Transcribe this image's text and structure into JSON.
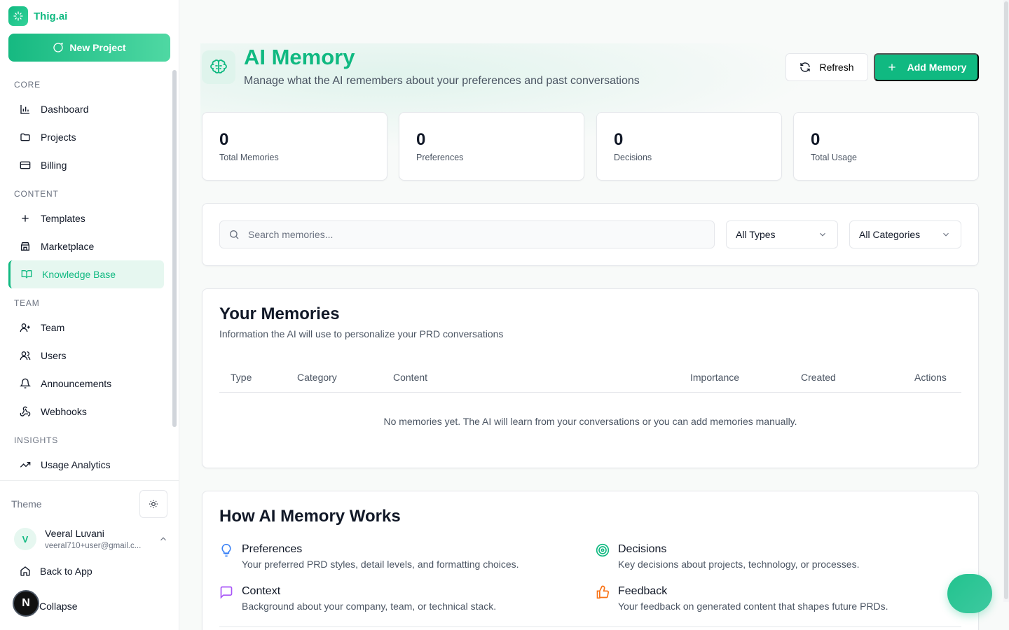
{
  "brand": {
    "name": "Thig.ai"
  },
  "sidebar": {
    "new_project": "New Project",
    "sections": [
      {
        "label": "CORE",
        "items": [
          {
            "label": "Dashboard",
            "icon": "bar-chart-icon"
          },
          {
            "label": "Projects",
            "icon": "folder-icon"
          },
          {
            "label": "Billing",
            "icon": "credit-card-icon"
          }
        ]
      },
      {
        "label": "CONTENT",
        "items": [
          {
            "label": "Templates",
            "icon": "plus-icon"
          },
          {
            "label": "Marketplace",
            "icon": "store-icon"
          },
          {
            "label": "Knowledge Base",
            "icon": "book-open-icon",
            "active": true
          }
        ]
      },
      {
        "label": "TEAM",
        "items": [
          {
            "label": "Team",
            "icon": "user-plus-icon"
          },
          {
            "label": "Users",
            "icon": "users-icon"
          },
          {
            "label": "Announcements",
            "icon": "bell-icon"
          },
          {
            "label": "Webhooks",
            "icon": "webhook-icon"
          }
        ]
      },
      {
        "label": "INSIGHTS",
        "items": [
          {
            "label": "Usage Analytics",
            "icon": "trending-up-icon"
          }
        ]
      }
    ],
    "theme_label": "Theme",
    "user": {
      "initial": "V",
      "name": "Veeral Luvani",
      "email": "veeral710+user@gmail.c..."
    },
    "back_to_app": "Back to App",
    "collapse": "Collapse",
    "badge": "N"
  },
  "header": {
    "title": "AI Memory",
    "subtitle": "Manage what the AI remembers about your preferences and past conversations",
    "refresh_label": "Refresh",
    "add_label": "Add Memory"
  },
  "stats": [
    {
      "value": "0",
      "label": "Total Memories"
    },
    {
      "value": "0",
      "label": "Preferences"
    },
    {
      "value": "0",
      "label": "Decisions"
    },
    {
      "value": "0",
      "label": "Total Usage"
    }
  ],
  "filters": {
    "search_placeholder": "Search memories...",
    "type_value": "All Types",
    "category_value": "All Categories"
  },
  "memories": {
    "title": "Your Memories",
    "subtitle": "Information the AI will use to personalize your PRD conversations",
    "columns": [
      "Type",
      "Category",
      "Content",
      "Importance",
      "Created",
      "Actions"
    ],
    "empty": "No memories yet. The AI will learn from your conversations or you can add memories manually."
  },
  "how": {
    "title": "How AI Memory Works",
    "features": [
      {
        "title": "Preferences",
        "desc": "Your preferred PRD styles, detail levels, and formatting choices.",
        "icon": "lightbulb-icon",
        "color": "#3b82f6"
      },
      {
        "title": "Decisions",
        "desc": "Key decisions about projects, technology, or processes.",
        "icon": "target-icon",
        "color": "#10b981"
      },
      {
        "title": "Context",
        "desc": "Background about your company, team, or technical stack.",
        "icon": "message-square-icon",
        "color": "#a855f7"
      },
      {
        "title": "Feedback",
        "desc": "Your feedback on generated content that shapes future PRDs.",
        "icon": "thumbs-up-icon",
        "color": "#f97316"
      }
    ]
  },
  "colors": {
    "accent": "#10b981"
  }
}
